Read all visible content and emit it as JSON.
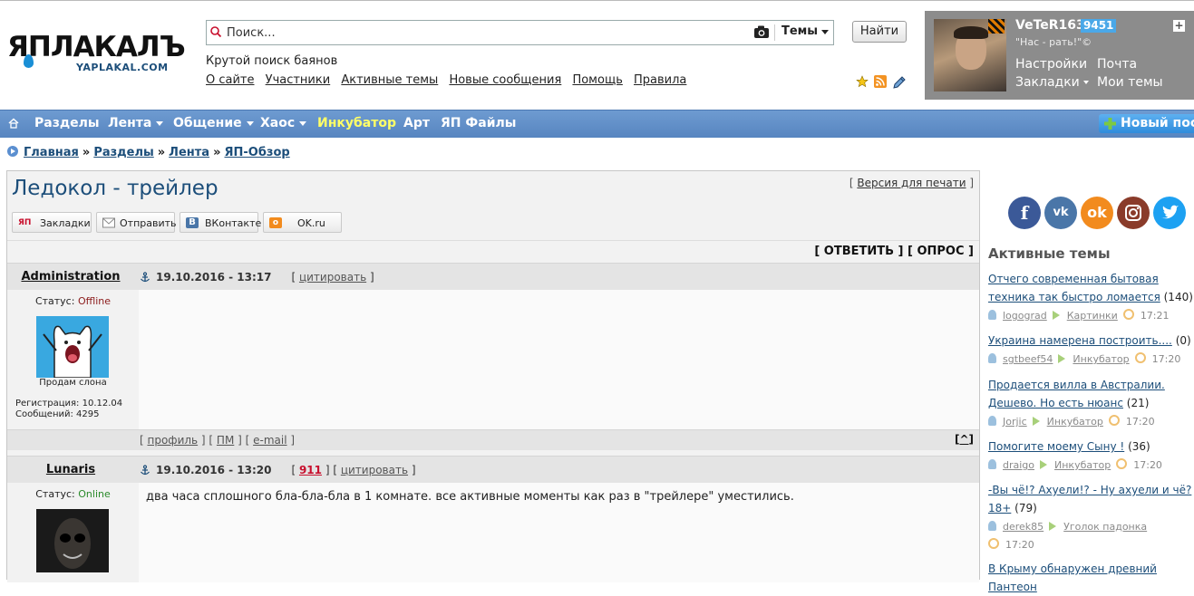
{
  "header": {
    "logo_text": "ЯПЛАКАЛЪ",
    "logo_domain": "YAPLAKAL.COM",
    "search": {
      "placeholder": "Поиск...",
      "scope": "Темы",
      "button": "Найти"
    },
    "slogan": "Крутой поиск баянов",
    "links": [
      "О сайте",
      "Участники",
      "Активные темы",
      "Новые сообщения",
      "Помощь",
      "Правила"
    ],
    "icons": [
      "star-icon",
      "rss-icon",
      "pencil-icon"
    ]
  },
  "user": {
    "name": "VeTeR163",
    "reputation": "9451",
    "motto": "\"Нас - рать!\"©",
    "links": [
      "Настройки",
      "Почта",
      "Закладки",
      "Мои темы"
    ]
  },
  "nav": {
    "items": [
      "Разделы",
      "Лента",
      "Общение",
      "Хаос",
      "Инкубатор",
      "Арт",
      "ЯП Файлы"
    ],
    "new_post": "Новый пост",
    "colors": {
      "bar": "#5f8cc7",
      "highlight": "#ffff66"
    }
  },
  "breadcrumbs": [
    "Главная",
    "Разделы",
    "Лента",
    "ЯП-Обзор"
  ],
  "topic": {
    "title": "Ледокол - трейлер",
    "print_version": "Версия для печати",
    "share": [
      "Закладки",
      "Отправить",
      "ВКонтакте",
      "OK.ru"
    ],
    "reply_label": "[ ОТВЕТИТЬ ] [ ОПРОС ]"
  },
  "posts": [
    {
      "author": "Administration",
      "date": "19.10.2016 - 13:17",
      "quote": "цитировать",
      "status_label": "Статус:",
      "status": "Offline",
      "avatar_caption": "Продам слона",
      "registration": "Регистрация: 10.12.04",
      "messages": "Сообщений: 4295",
      "text": "",
      "footer_links": [
        "профиль",
        "ПМ",
        "e-mail"
      ],
      "top_link": "^"
    },
    {
      "author": "Lunaris",
      "date": "19.10.2016 - 13:20",
      "rating": "911",
      "quote": "цитировать",
      "status_label": "Статус:",
      "status": "Online",
      "text": "два часа сплошного бла-бла-бла в 1 комнате. все активные моменты как раз в \"трейлере\" уместились."
    }
  ],
  "sidebar": {
    "social": [
      "f",
      "vk",
      "ok",
      "ig",
      "tw"
    ],
    "active_title": "Активные темы",
    "active_topics": [
      {
        "title": "Отчего современная бытовая техника так быстро ломается",
        "count": "(140)",
        "user": "logograd",
        "section": "Картинки",
        "time": "17:21"
      },
      {
        "title": "Украина намерена построить....",
        "count": "(0)",
        "user": "sgtbeef54",
        "section": "Инкубатор",
        "time": "17:20"
      },
      {
        "title": "Продается вилла в Австралии. Дешево. Но есть нюанс",
        "count": "(21)",
        "user": "Jorjic",
        "section": "Инкубатор",
        "time": "17:20"
      },
      {
        "title": "Помогите моему Сыну !",
        "count": "(36)",
        "user": "draigo",
        "section": "Инкубатор",
        "time": "17:20"
      },
      {
        "title": "-Вы чё!? Ахуели!? - Ну ахуели и чё? 18+",
        "count": "(79)",
        "user": "derek85",
        "section": "Уголок падонка",
        "time": "17:20"
      },
      {
        "title": "В Крыму обнаружен древний Пантеон",
        "count": "",
        "user": "",
        "section": "",
        "time": ""
      }
    ]
  }
}
